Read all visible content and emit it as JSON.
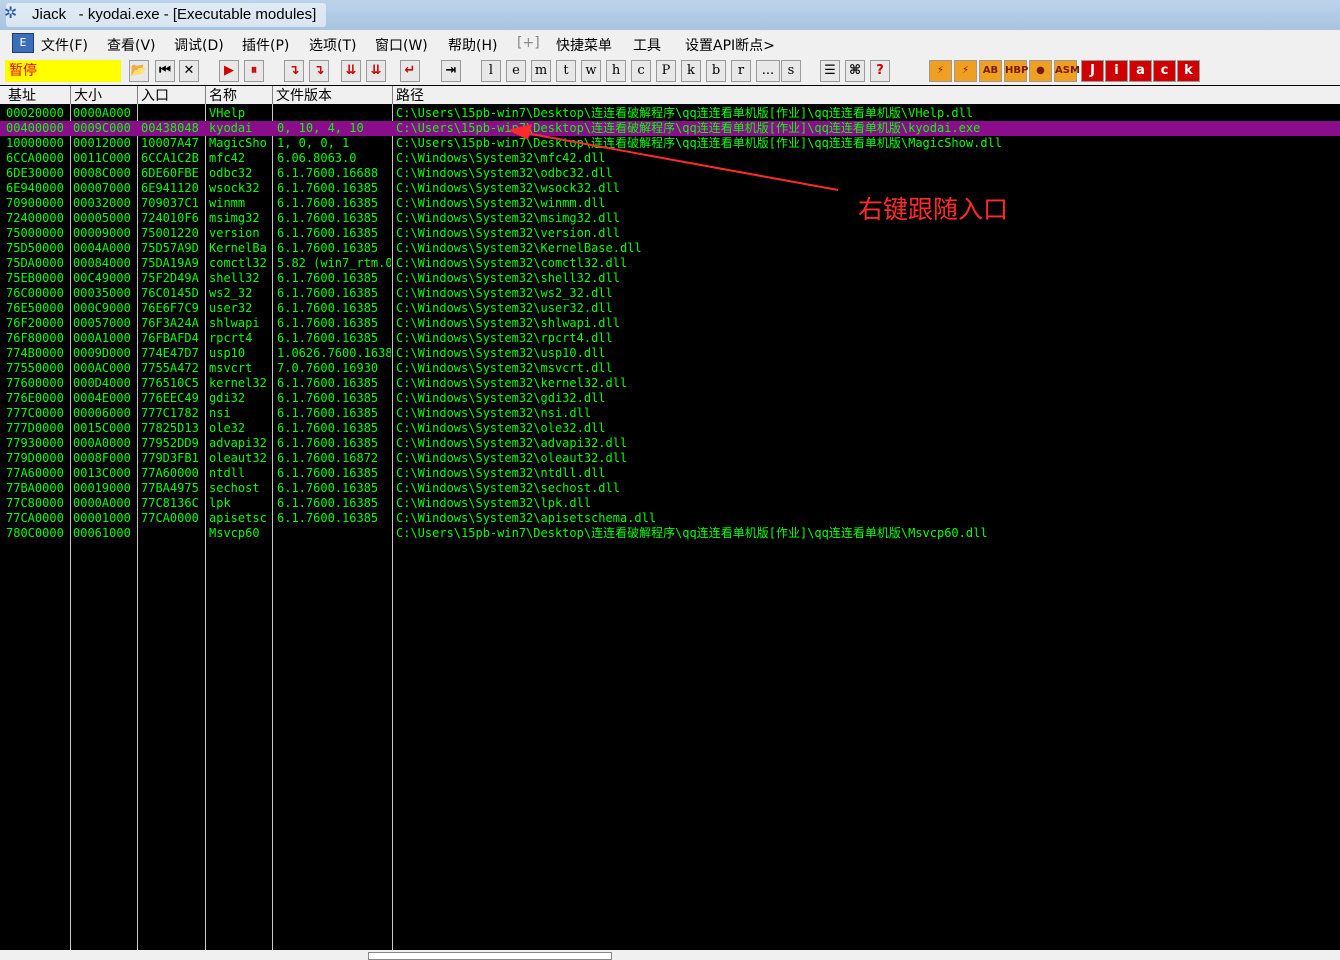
{
  "window": {
    "title": "Jiack   - kyodai.exe - [Executable modules]"
  },
  "menu": [
    {
      "label": "文件(F)",
      "dim": false
    },
    {
      "label": "查看(V)",
      "dim": false
    },
    {
      "label": "调试(D)",
      "dim": false
    },
    {
      "label": "插件(P)",
      "dim": false
    },
    {
      "label": "选项(T)",
      "dim": false
    },
    {
      "label": "窗口(W)",
      "dim": false
    },
    {
      "label": "帮助(H)",
      "dim": false
    },
    {
      "label": "[+]",
      "dim": true
    },
    {
      "label": "快捷菜单",
      "dim": false
    },
    {
      "label": "工具",
      "dim": false
    },
    {
      "label": "设置API断点>",
      "dim": false
    }
  ],
  "status": "暂停",
  "toolbar": {
    "control_buttons": [
      "▶",
      "⏸",
      "↴",
      "↴",
      "⇊",
      "⇊",
      "↵",
      "⇥"
    ],
    "window_letters": [
      "l",
      "e",
      "m",
      "t",
      "w",
      "h",
      "c",
      "P",
      "k",
      "b",
      "r",
      "...",
      "s"
    ],
    "misc_buttons": [
      "☰",
      "⌘",
      "?"
    ],
    "plugin_buttons": [
      "⚡",
      "⚡",
      "AB",
      "HBP",
      "●",
      "ASM"
    ],
    "logo_letters": [
      "J",
      "i",
      "a",
      "c",
      "k"
    ]
  },
  "columns": {
    "base": "基址",
    "size": "大小",
    "entry": "入口",
    "name": "名称",
    "version": "文件版本",
    "path": "路径"
  },
  "modules": [
    {
      "base": "00020000",
      "size": "0000A000",
      "entry": "",
      "name": "VHelp",
      "version": "",
      "path": "C:\\Users\\15pb-win7\\Desktop\\连连看破解程序\\qq连连看单机版[作业]\\qq连连看单机版\\VHelp.dll"
    },
    {
      "base": "00400000",
      "size": "0009C000",
      "entry": "00438048",
      "name": "kyodai",
      "version": "0, 10, 4, 10",
      "path": "C:\\Users\\15pb-win7\\Desktop\\连连看破解程序\\qq连连看单机版[作业]\\qq连连看单机版\\kyodai.exe"
    },
    {
      "base": "10000000",
      "size": "00012000",
      "entry": "10007A47",
      "name": "MagicSho",
      "version": "1, 0, 0, 1",
      "path": "C:\\Users\\15pb-win7\\Desktop\\连连看破解程序\\qq连连看单机版[作业]\\qq连连看单机版\\MagicShow.dll"
    },
    {
      "base": "6CCA0000",
      "size": "0011C000",
      "entry": "6CCA1C2B",
      "name": "mfc42",
      "version": "6.06.8063.0",
      "path": "C:\\Windows\\System32\\mfc42.dll"
    },
    {
      "base": "6DE30000",
      "size": "0008C000",
      "entry": "6DE60FBE",
      "name": "odbc32",
      "version": "6.1.7600.16688",
      "path": "C:\\Windows\\System32\\odbc32.dll"
    },
    {
      "base": "6E940000",
      "size": "00007000",
      "entry": "6E941120",
      "name": "wsock32",
      "version": "6.1.7600.16385",
      "path": "C:\\Windows\\System32\\wsock32.dll"
    },
    {
      "base": "70900000",
      "size": "00032000",
      "entry": "709037C1",
      "name": "winmm",
      "version": "6.1.7600.16385",
      "path": "C:\\Windows\\System32\\winmm.dll"
    },
    {
      "base": "72400000",
      "size": "00005000",
      "entry": "724010F6",
      "name": "msimg32",
      "version": "6.1.7600.16385",
      "path": "C:\\Windows\\System32\\msimg32.dll"
    },
    {
      "base": "75000000",
      "size": "00009000",
      "entry": "75001220",
      "name": "version",
      "version": "6.1.7600.16385",
      "path": "C:\\Windows\\System32\\version.dll"
    },
    {
      "base": "75D50000",
      "size": "0004A000",
      "entry": "75D57A9D",
      "name": "KernelBa",
      "version": "6.1.7600.16385",
      "path": "C:\\Windows\\System32\\KernelBase.dll"
    },
    {
      "base": "75DA0000",
      "size": "00084000",
      "entry": "75DA19A9",
      "name": "comctl32",
      "version": "5.82 (win7_rtm.0",
      "path": "C:\\Windows\\System32\\comctl32.dll"
    },
    {
      "base": "75EB0000",
      "size": "00C49000",
      "entry": "75F2D49A",
      "name": "shell32",
      "version": "6.1.7600.16385",
      "path": "C:\\Windows\\System32\\shell32.dll"
    },
    {
      "base": "76C00000",
      "size": "00035000",
      "entry": "76C0145D",
      "name": "ws2_32",
      "version": "6.1.7600.16385",
      "path": "C:\\Windows\\System32\\ws2_32.dll"
    },
    {
      "base": "76E50000",
      "size": "000C9000",
      "entry": "76E6F7C9",
      "name": "user32",
      "version": "6.1.7600.16385",
      "path": "C:\\Windows\\System32\\user32.dll"
    },
    {
      "base": "76F20000",
      "size": "00057000",
      "entry": "76F3A24A",
      "name": "shlwapi",
      "version": "6.1.7600.16385",
      "path": "C:\\Windows\\System32\\shlwapi.dll"
    },
    {
      "base": "76F80000",
      "size": "000A1000",
      "entry": "76FBAFD4",
      "name": "rpcrt4",
      "version": "6.1.7600.16385",
      "path": "C:\\Windows\\System32\\rpcrt4.dll"
    },
    {
      "base": "774B0000",
      "size": "0009D000",
      "entry": "774E47D7",
      "name": "usp10",
      "version": "1.0626.7600.1638",
      "path": "C:\\Windows\\System32\\usp10.dll"
    },
    {
      "base": "77550000",
      "size": "000AC000",
      "entry": "7755A472",
      "name": "msvcrt",
      "version": "7.0.7600.16930",
      "path": "C:\\Windows\\System32\\msvcrt.dll"
    },
    {
      "base": "77600000",
      "size": "000D4000",
      "entry": "776510C5",
      "name": "kernel32",
      "version": "6.1.7600.16385",
      "path": "C:\\Windows\\System32\\kernel32.dll"
    },
    {
      "base": "776E0000",
      "size": "0004E000",
      "entry": "776EEC49",
      "name": "gdi32",
      "version": "6.1.7600.16385",
      "path": "C:\\Windows\\System32\\gdi32.dll"
    },
    {
      "base": "777C0000",
      "size": "00006000",
      "entry": "777C1782",
      "name": "nsi",
      "version": "6.1.7600.16385",
      "path": "C:\\Windows\\System32\\nsi.dll"
    },
    {
      "base": "777D0000",
      "size": "0015C000",
      "entry": "77825D13",
      "name": "ole32",
      "version": "6.1.7600.16385",
      "path": "C:\\Windows\\System32\\ole32.dll"
    },
    {
      "base": "77930000",
      "size": "000A0000",
      "entry": "77952DD9",
      "name": "advapi32",
      "version": "6.1.7600.16385",
      "path": "C:\\Windows\\System32\\advapi32.dll"
    },
    {
      "base": "779D0000",
      "size": "0008F000",
      "entry": "779D3FB1",
      "name": "oleaut32",
      "version": "6.1.7600.16872",
      "path": "C:\\Windows\\System32\\oleaut32.dll"
    },
    {
      "base": "77A60000",
      "size": "0013C000",
      "entry": "77A60000",
      "name": "ntdll",
      "version": "6.1.7600.16385",
      "path": "C:\\Windows\\System32\\ntdll.dll"
    },
    {
      "base": "77BA0000",
      "size": "00019000",
      "entry": "77BA4975",
      "name": "sechost",
      "version": "6.1.7600.16385",
      "path": "C:\\Windows\\System32\\sechost.dll"
    },
    {
      "base": "77C80000",
      "size": "0000A000",
      "entry": "77C8136C",
      "name": "lpk",
      "version": "6.1.7600.16385",
      "path": "C:\\Windows\\System32\\lpk.dll"
    },
    {
      "base": "77CA0000",
      "size": "00001000",
      "entry": "77CA0000",
      "name": "apisetsc",
      "version": "6.1.7600.16385",
      "path": "C:\\Windows\\System32\\apisetschema.dll"
    },
    {
      "base": "780C0000",
      "size": "00061000",
      "entry": "",
      "name": "Msvcp60",
      "version": "",
      "path": "C:\\Users\\15pb-win7\\Desktop\\连连看破解程序\\qq连连看单机版[作业]\\qq连连看单机版\\Msvcp60.dll"
    }
  ],
  "selected_row": 1,
  "annotation": "右键跟随入口",
  "colors": {
    "text": "#00ff00",
    "selection": "#8b0d8b",
    "annotation": "#ff2a2a",
    "status_bg": "#ffff00",
    "status_text": "#ff0000"
  }
}
